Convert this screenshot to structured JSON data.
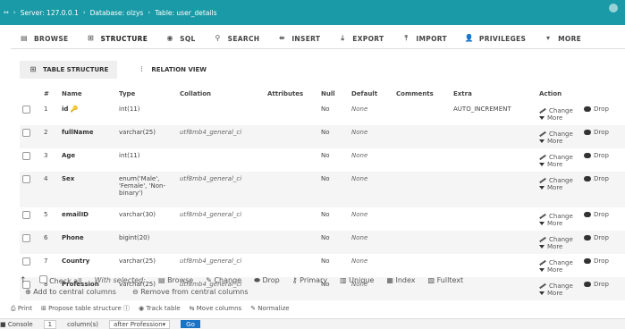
{
  "breadcrumb": {
    "server": "Server: 127.0.0.1",
    "database": "Database: olzys",
    "table": "Table: user_details"
  },
  "top_tabs": [
    {
      "label": "BROWSE",
      "icon": "browse-icon"
    },
    {
      "label": "STRUCTURE",
      "icon": "structure-icon",
      "active": true
    },
    {
      "label": "SQL",
      "icon": "sql-icon"
    },
    {
      "label": "SEARCH",
      "icon": "search-icon"
    },
    {
      "label": "INSERT",
      "icon": "insert-icon"
    },
    {
      "label": "EXPORT",
      "icon": "export-icon"
    },
    {
      "label": "IMPORT",
      "icon": "import-icon"
    },
    {
      "label": "PRIVILEGES",
      "icon": "privileges-icon"
    },
    {
      "label": "MORE",
      "icon": "more-icon"
    }
  ],
  "sub_tabs": [
    {
      "label": "TABLE STRUCTURE",
      "icon": "table-structure-icon"
    },
    {
      "label": "RELATION VIEW",
      "icon": "relation-view-icon"
    }
  ],
  "table": {
    "headers": [
      "#",
      "Name",
      "Type",
      "Collation",
      "Attributes",
      "Null",
      "Default",
      "Comments",
      "Extra",
      "Action"
    ],
    "rows": [
      {
        "num": "1",
        "name": "id",
        "type": "int(11)",
        "collation": "",
        "null": "No",
        "default": "None",
        "extra": "AUTO_INCREMENT"
      },
      {
        "num": "2",
        "name": "fullName",
        "type": "varchar(25)",
        "collation": "utf8mb4_general_ci",
        "null": "No",
        "default": "None",
        "extra": ""
      },
      {
        "num": "3",
        "name": "Age",
        "type": "int(11)",
        "collation": "",
        "null": "No",
        "default": "None",
        "extra": ""
      },
      {
        "num": "4",
        "name": "Sex",
        "type": "enum('Male', 'Female', 'Non-binary')",
        "collation": "utf8mb4_general_ci",
        "null": "No",
        "default": "None",
        "extra": ""
      },
      {
        "num": "5",
        "name": "emailID",
        "type": "varchar(30)",
        "collation": "utf8mb4_general_ci",
        "null": "No",
        "default": "None",
        "extra": ""
      },
      {
        "num": "6",
        "name": "Phone",
        "type": "bigint(20)",
        "collation": "",
        "null": "No",
        "default": "None",
        "extra": ""
      },
      {
        "num": "7",
        "name": "Country",
        "type": "varchar(25)",
        "collation": "utf8mb4_general_ci",
        "null": "No",
        "default": "None",
        "extra": ""
      },
      {
        "num": "8",
        "name": "Profession",
        "type": "varchar(25)",
        "collation": "utf8mb4_general_ci",
        "null": "No",
        "default": "None",
        "extra": ""
      }
    ],
    "actions": {
      "change": "Change",
      "drop": "Drop",
      "more": "More"
    }
  },
  "bulk": {
    "check_all": "Check all",
    "with_selected": "With selected:",
    "browse": "Browse",
    "change": "Change",
    "drop": "Drop",
    "primary": "Primary",
    "unique": "Unique",
    "index": "Index",
    "fulltext": "Fulltext",
    "add_central": "Add to central columns",
    "remove_central": "Remove from central columns"
  },
  "footer_links": {
    "print": "Print",
    "propose": "Propose table structure",
    "track": "Track table",
    "move": "Move columns",
    "normalize": "Normalize"
  },
  "console": {
    "label": "Console",
    "add_count": "1",
    "columns_label": "column(s)",
    "position": "after Profession",
    "go": "Go"
  }
}
